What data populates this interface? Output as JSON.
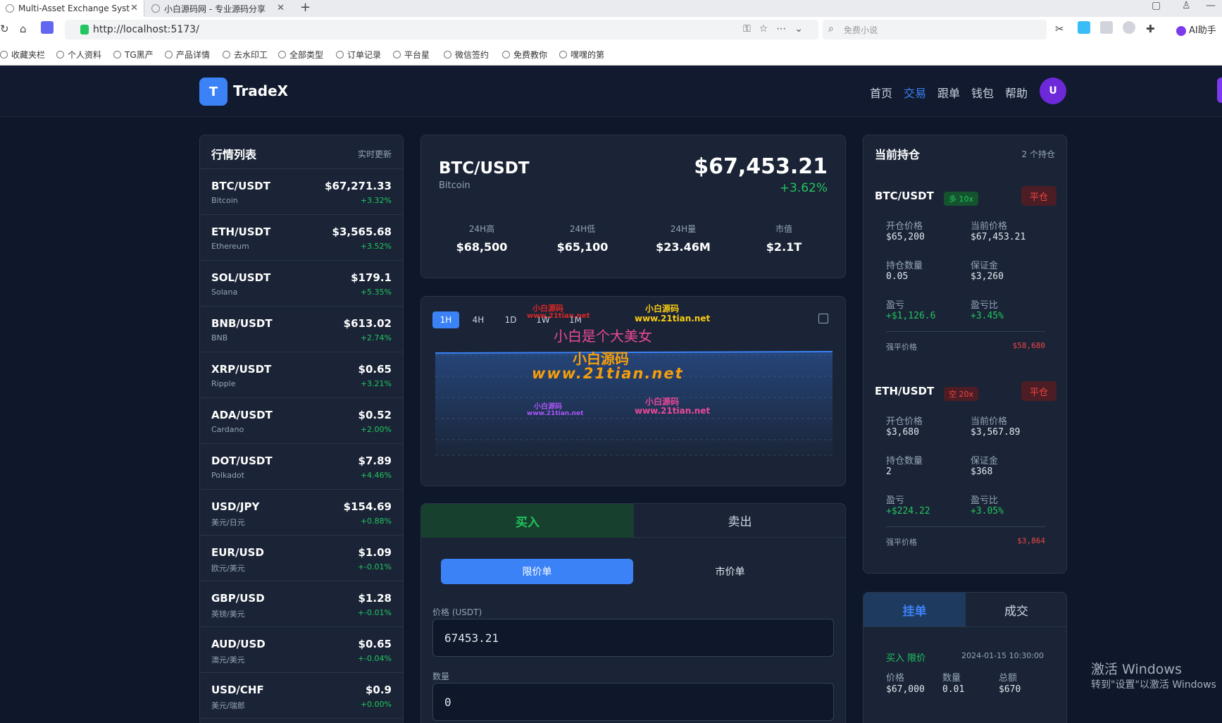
{
  "browser": {
    "tabs": [
      {
        "title": "Multi-Asset Exchange Syst"
      },
      {
        "title": "小白源码网 - 专业源码分享"
      }
    ],
    "new_tab": "+",
    "url": "http://localhost:5173/",
    "search_placeholder": "免费小说",
    "ai_assistant": "AI助手",
    "bookmarks": [
      "收藏夹栏",
      "个人资料",
      "TG黑产",
      "产品详情",
      "去水印工",
      "全部类型",
      "订单记录",
      "平台星",
      "微信签约",
      "免费教你",
      "嘿嘿的第"
    ]
  },
  "app": {
    "logo_letter": "T",
    "brand": "TradeX",
    "nav": [
      "首页",
      "交易",
      "跟单",
      "钱包",
      "帮助"
    ],
    "active_nav": "交易",
    "avatar": "U"
  },
  "market": {
    "title": "行情列表",
    "live": "实时更新",
    "items": [
      {
        "symbol": "BTC/USDT",
        "name": "Bitcoin",
        "price": "$67,271.33",
        "change": "+3.32%"
      },
      {
        "symbol": "ETH/USDT",
        "name": "Ethereum",
        "price": "$3,565.68",
        "change": "+3.52%"
      },
      {
        "symbol": "SOL/USDT",
        "name": "Solana",
        "price": "$179.1",
        "change": "+5.35%"
      },
      {
        "symbol": "BNB/USDT",
        "name": "BNB",
        "price": "$613.02",
        "change": "+2.74%"
      },
      {
        "symbol": "XRP/USDT",
        "name": "Ripple",
        "price": "$0.65",
        "change": "+3.21%"
      },
      {
        "symbol": "ADA/USDT",
        "name": "Cardano",
        "price": "$0.52",
        "change": "+2.00%"
      },
      {
        "symbol": "DOT/USDT",
        "name": "Polkadot",
        "price": "$7.89",
        "change": "+4.46%"
      },
      {
        "symbol": "USD/JPY",
        "name": "美元/日元",
        "price": "$154.69",
        "change": "+0.88%"
      },
      {
        "symbol": "EUR/USD",
        "name": "欧元/美元",
        "price": "$1.09",
        "change": "+-0.01%"
      },
      {
        "symbol": "GBP/USD",
        "name": "英镑/美元",
        "price": "$1.28",
        "change": "+-0.01%"
      },
      {
        "symbol": "AUD/USD",
        "name": "澳元/美元",
        "price": "$0.65",
        "change": "+-0.04%"
      },
      {
        "symbol": "USD/CHF",
        "name": "美元/瑞郎",
        "price": "$0.9",
        "change": "+0.00%"
      }
    ]
  },
  "ticker": {
    "symbol": "BTC/USDT",
    "name": "Bitcoin",
    "price": "$67,453.21",
    "change": "+3.62%",
    "stats": [
      {
        "label": "24H高",
        "value": "$68,500"
      },
      {
        "label": "24H低",
        "value": "$65,100"
      },
      {
        "label": "24H量",
        "value": "$23.46M"
      },
      {
        "label": "市值",
        "value": "$2.1T"
      }
    ]
  },
  "chart": {
    "intervals": [
      "1H",
      "4H",
      "1D",
      "1W",
      "1M"
    ],
    "active_interval": "1H",
    "watermarks": [
      "小白源码",
      "www.21tian.net",
      "小白源码",
      "www.21tian.net",
      "小白是个大美女",
      "小白源码",
      "www.21tian.net",
      "小白源码",
      "www.21tian.net",
      "小白源码",
      "www.21tian.net"
    ]
  },
  "order_form": {
    "buy": "买入",
    "sell": "卖出",
    "limit": "限价单",
    "market": "市价单",
    "price_label": "价格 (USDT)",
    "price_value": "67453.21",
    "qty_label": "数量",
    "qty_value": "0"
  },
  "positions": {
    "title": "当前持仓",
    "count": "2 个持仓",
    "close_label": "平仓",
    "liq_label": "强平价格",
    "items": [
      {
        "symbol": "BTC/USDT",
        "badge": "多 10x",
        "side": "long",
        "open_label": "开仓价格",
        "open": "$65,200",
        "cur_label": "当前价格",
        "cur": "$67,453.21",
        "qty_label": "持仓数量",
        "qty": "0.05",
        "margin_label": "保证金",
        "margin": "$3,260",
        "pnl_label": "盈亏",
        "pnl": "+$1,126.6",
        "pnlr_label": "盈亏比",
        "pnlr": "+3.45%",
        "liq": "$58,680"
      },
      {
        "symbol": "ETH/USDT",
        "badge": "空 20x",
        "side": "short",
        "open_label": "开仓价格",
        "open": "$3,680",
        "cur_label": "当前价格",
        "cur": "$3,567.89",
        "qty_label": "持仓数量",
        "qty": "2",
        "margin_label": "保证金",
        "margin": "$368",
        "pnl_label": "盈亏",
        "pnl": "+$224.22",
        "pnlr_label": "盈亏比",
        "pnlr": "+3.05%",
        "liq": "$3,864"
      }
    ]
  },
  "orders": {
    "tab_open": "挂单",
    "tab_filled": "成交",
    "item": {
      "side": "买入 限价",
      "time": "2024-01-15 10:30:00",
      "price_label": "价格",
      "price": "$67,000",
      "qty_label": "数量",
      "qty": "0.01",
      "total_label": "总额",
      "total": "$670"
    }
  },
  "windows_activation": {
    "line1": "激活 Windows",
    "line2": "转到\"设置\"以激活 Windows"
  }
}
